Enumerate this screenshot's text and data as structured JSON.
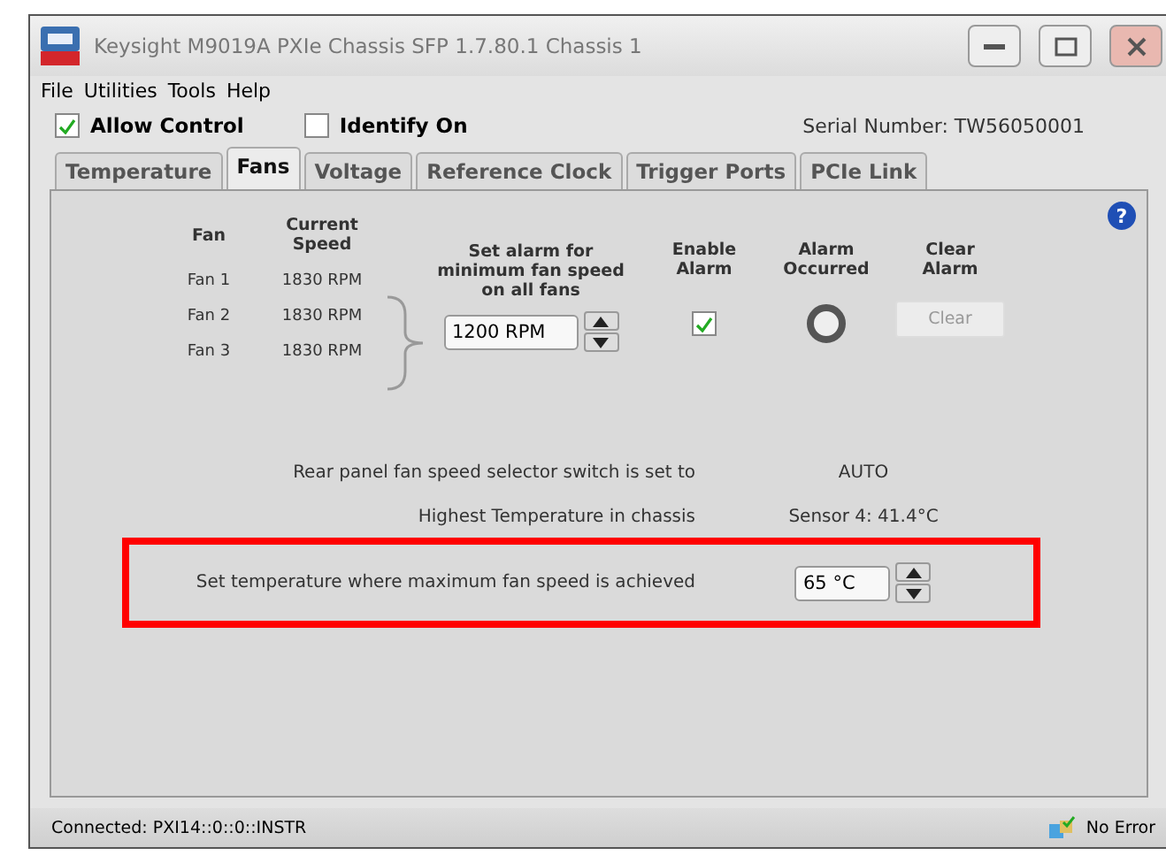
{
  "window": {
    "title": "Keysight M9019A PXIe Chassis SFP 1.7.80.1 Chassis 1"
  },
  "menu": [
    "File",
    "Utilities",
    "Tools",
    "Help"
  ],
  "controls": [
    {
      "label": "Allow Control",
      "checked": true
    },
    {
      "label": "Identify On",
      "checked": false
    }
  ],
  "serial": "Serial Number: TW56050001",
  "tabs": [
    {
      "label": "Temperature",
      "selected": false
    },
    {
      "label": "Fans",
      "selected": true
    },
    {
      "label": "Voltage",
      "selected": false
    },
    {
      "label": "Reference Clock",
      "selected": false
    },
    {
      "label": "Trigger Ports",
      "selected": false
    },
    {
      "label": "PCIe Link",
      "selected": false
    }
  ],
  "help": "?",
  "fan_table": {
    "headers": [
      "Fan",
      "Current Speed"
    ],
    "rows": [
      {
        "name": "Fan 1",
        "speed": "1830 RPM"
      },
      {
        "name": "Fan 2",
        "speed": "1830 RPM"
      },
      {
        "name": "Fan 3",
        "speed": "1830 RPM"
      }
    ]
  },
  "alarm_setting": {
    "heading": "Set alarm for minimum fan speed on all fans",
    "value": "1200 RPM"
  },
  "enable_alarm": {
    "heading": "Enable Alarm",
    "checked": true
  },
  "alarm_occurred": {
    "heading": "Alarm Occurred"
  },
  "clear_alarm": {
    "heading": "Clear Alarm",
    "button": "Clear",
    "disabled": true
  },
  "info_rows": [
    {
      "label": "Rear panel fan speed selector switch is set to",
      "value": "AUTO"
    },
    {
      "label": "Highest Temperature in chassis",
      "value": "Sensor 4: 41.4°C"
    }
  ],
  "max_speed_setting": {
    "label": "Set temperature where maximum fan speed is achieved",
    "value": "65 °C",
    "highlighted": true
  },
  "status_bar": {
    "connection": "Connected: PXI14::0::0::INSTR",
    "error": "No Error"
  }
}
